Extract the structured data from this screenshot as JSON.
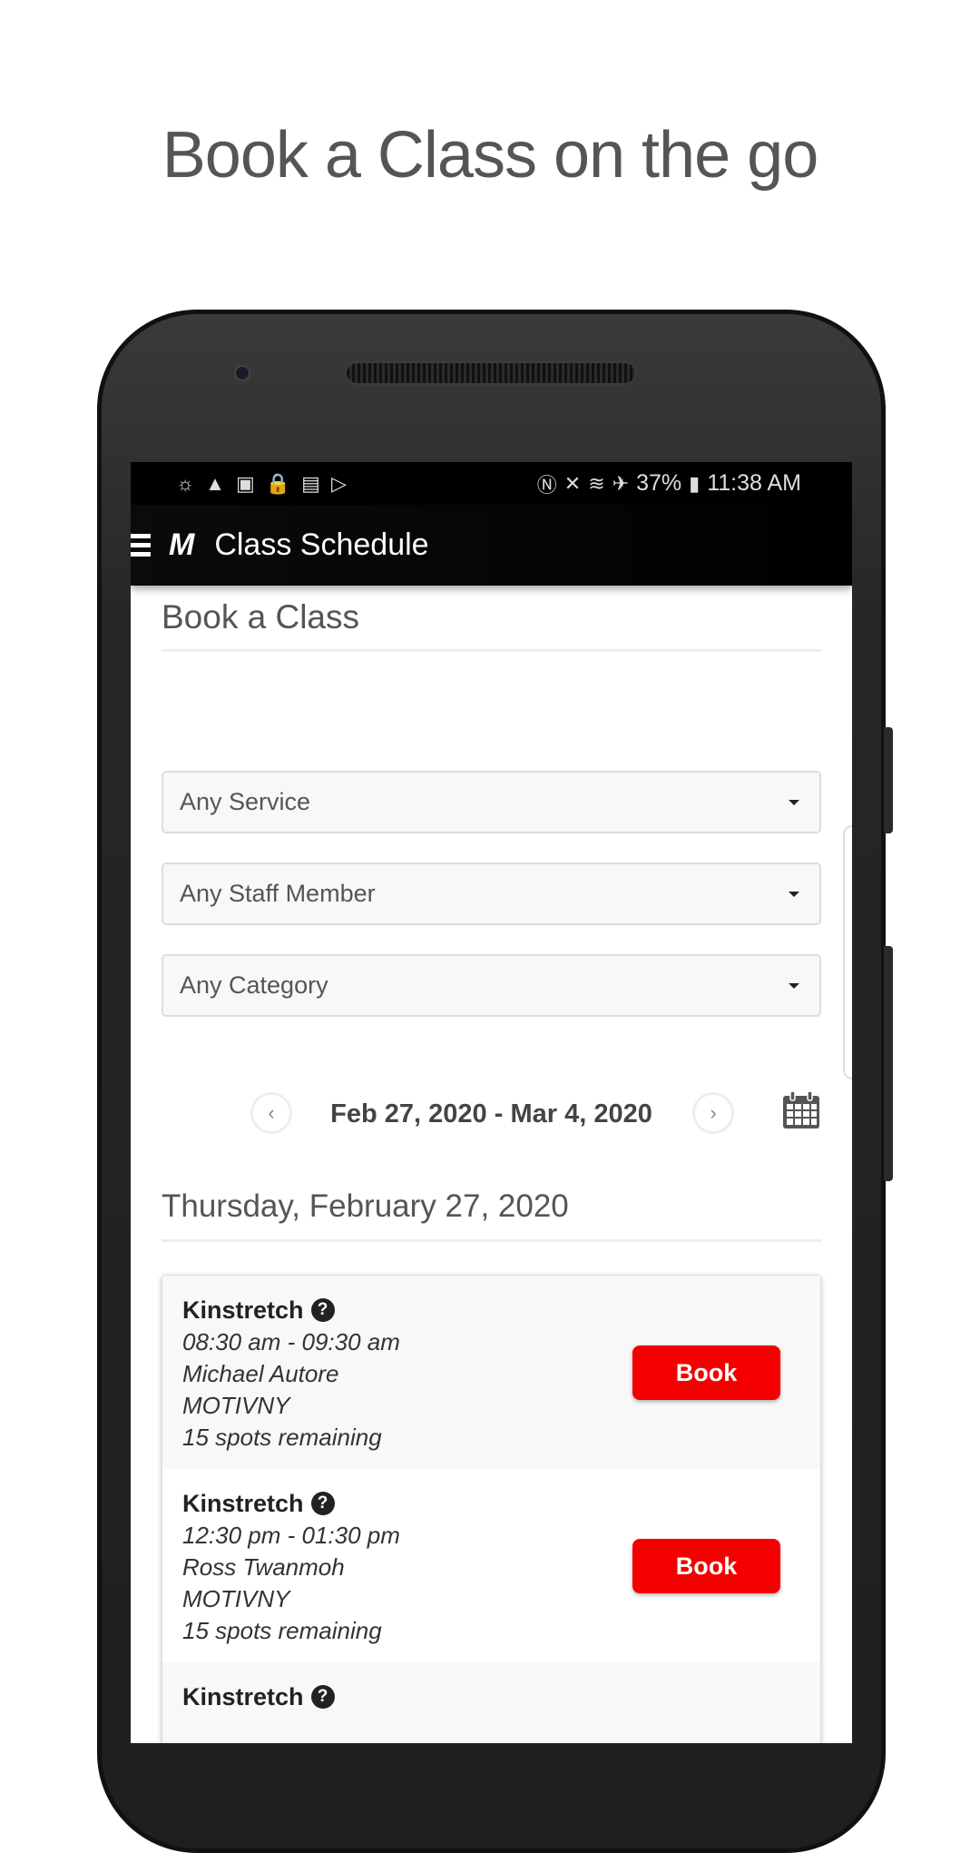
{
  "headline": "Book a Class on the go",
  "status_bar": {
    "battery": "37%",
    "time": "11:38 AM",
    "left_icons": [
      "weather-icon",
      "warning-icon",
      "image-icon",
      "lock-warning-icon",
      "sim-icon",
      "play-store-icon"
    ],
    "right_icons": [
      "nfc-icon",
      "mute-icon",
      "wifi-icon",
      "airplane-icon",
      "battery-icon"
    ]
  },
  "app_bar": {
    "logo": "M",
    "title": "Class Schedule"
  },
  "page": {
    "heading": "Book a Class",
    "filters": [
      {
        "value": "Any Service"
      },
      {
        "value": "Any Staff Member"
      },
      {
        "value": "Any Category"
      }
    ],
    "date_range": "Feb 27, 2020 - Mar 4, 2020",
    "prev": "‹",
    "next": "›",
    "day_heading": "Thursday, February 27, 2020",
    "classes": [
      {
        "name": "Kinstretch",
        "time": "08:30 am - 09:30 am",
        "staff": "Michael Autore",
        "location": "MOTIVNY",
        "spots": "15 spots remaining",
        "button": "Book"
      },
      {
        "name": "Kinstretch",
        "time": "12:30 pm - 01:30 pm",
        "staff": "Ross Twanmoh",
        "location": "MOTIVNY",
        "spots": "15 spots remaining",
        "button": "Book"
      },
      {
        "name": "Kinstretch"
      }
    ]
  },
  "colors": {
    "accent": "#f40000",
    "app_bar": "#000000"
  }
}
